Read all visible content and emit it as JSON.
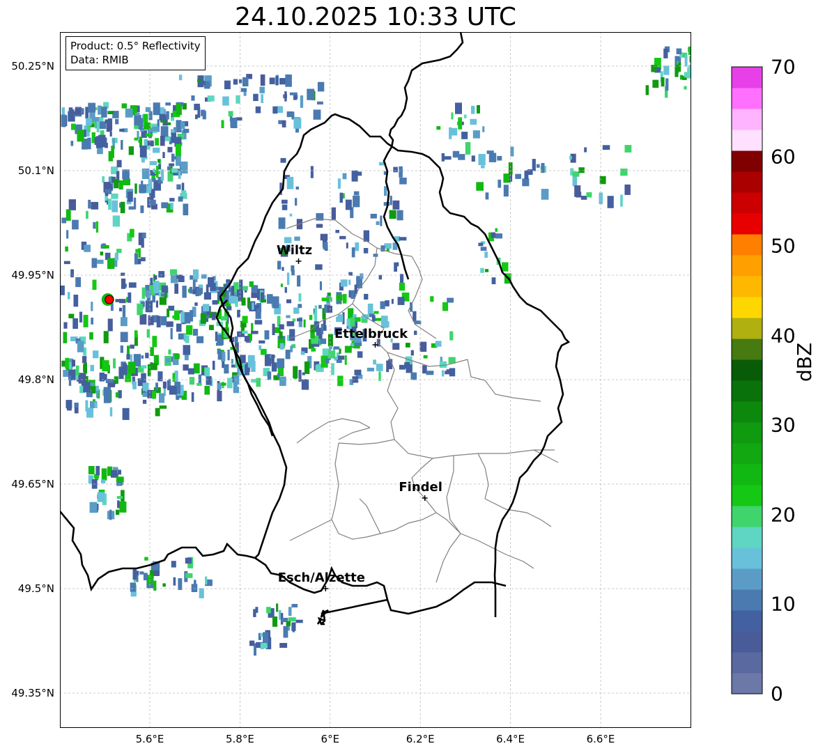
{
  "title": "24.10.2025 10:33 UTC",
  "info": {
    "product": "Product: 0.5° Reflectivity",
    "data": "Data: RMIB"
  },
  "axes": {
    "lon_range": [
      5.4,
      6.8
    ],
    "lat_range": [
      49.3,
      50.3
    ],
    "x_ticks": [
      "5.6°E",
      "5.8°E",
      "6°E",
      "6.2°E",
      "6.4°E",
      "6.6°E"
    ],
    "y_ticks": [
      "50.25°N",
      "50.1°N",
      "49.95°N",
      "49.8°N",
      "49.65°N",
      "49.5°N",
      "49.35°N"
    ]
  },
  "cities": [
    {
      "name": "Wiltz",
      "lon": 5.93,
      "lat": 49.97
    },
    {
      "name": "Ettelbruck",
      "lon": 6.1,
      "lat": 49.85
    },
    {
      "name": "Findel",
      "lon": 6.21,
      "lat": 49.63
    },
    {
      "name": "Esch/Alzette",
      "lon": 5.99,
      "lat": 49.5
    }
  ],
  "radar_site": {
    "lon": 5.51,
    "lat": 49.915,
    "color": "#ff0000"
  },
  "colorbar": {
    "label": "dBZ",
    "min": 0,
    "max": 70,
    "ticks": [
      "70",
      "60",
      "50",
      "40",
      "30",
      "20",
      "10",
      "0"
    ],
    "colors": [
      "#6b78a8",
      "#5a6aa0",
      "#4a5b9a",
      "#4360a0",
      "#4a7ab0",
      "#5a9cc6",
      "#68c1da",
      "#5ed6c2",
      "#3fd46c",
      "#14c814",
      "#12b812",
      "#12a812",
      "#0f9a0f",
      "#0c880c",
      "#0a720a",
      "#085c08",
      "#477a10",
      "#b0b010",
      "#ffd700",
      "#ffb800",
      "#ffa000",
      "#ff8000",
      "#e80000",
      "#cc0000",
      "#aa0000",
      "#800000",
      "#ffe0ff",
      "#ffb4ff",
      "#ff70ff",
      "#e840e8"
    ]
  }
}
